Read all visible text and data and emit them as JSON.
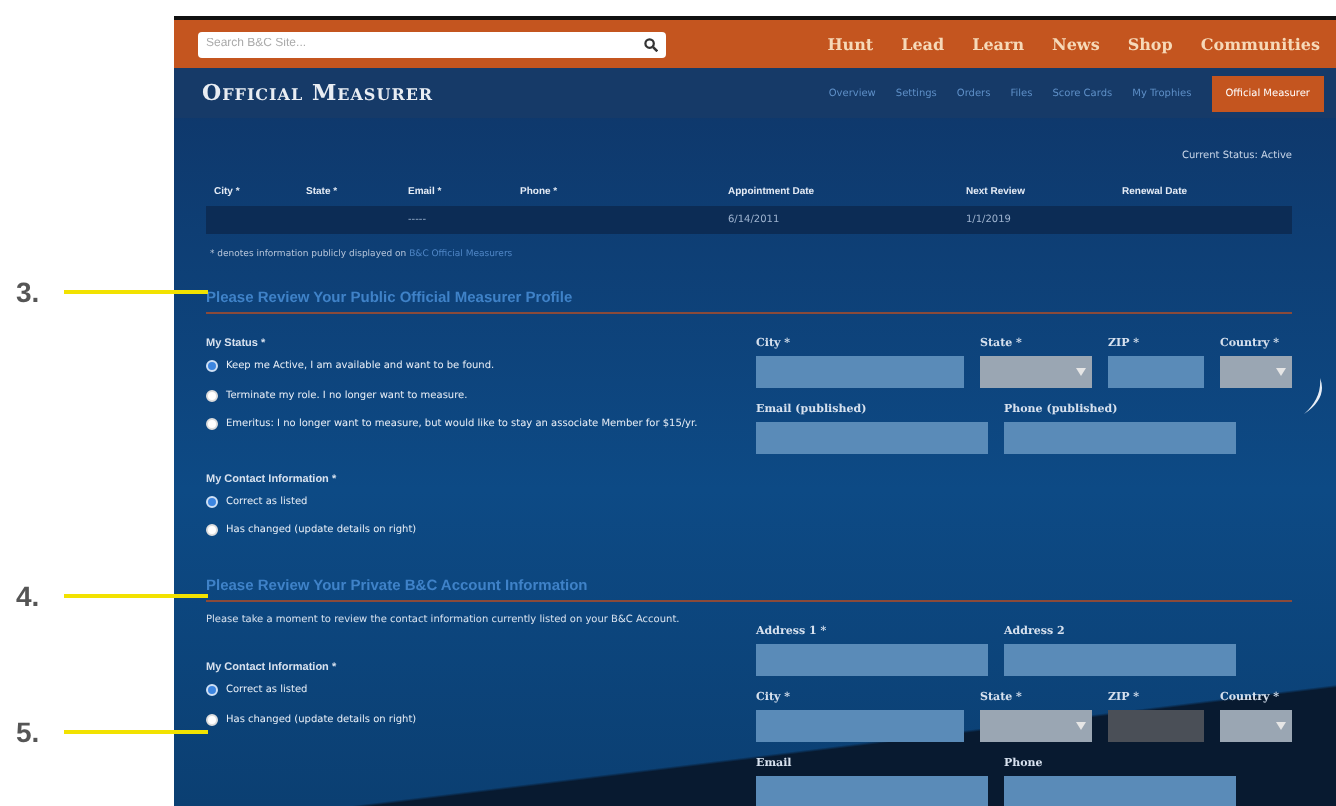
{
  "callouts": [
    {
      "label": "3."
    },
    {
      "label": "4."
    },
    {
      "label": "5."
    }
  ],
  "search": {
    "placeholder": "Search B&C Site..."
  },
  "main_nav": [
    "Hunt",
    "Lead",
    "Learn",
    "News",
    "Shop",
    "Communities"
  ],
  "site_title": "Official Measurer",
  "sub_nav": [
    {
      "label": "Overview",
      "selected": false
    },
    {
      "label": "Settings",
      "selected": false
    },
    {
      "label": "Orders",
      "selected": false
    },
    {
      "label": "Files",
      "selected": false
    },
    {
      "label": "Score Cards",
      "selected": false
    },
    {
      "label": "My Trophies",
      "selected": false
    },
    {
      "label": "Official Measurer",
      "selected": true
    }
  ],
  "current_status": "Current Status: Active",
  "table": {
    "columns": [
      "City *",
      "State *",
      "Email *",
      "Phone *",
      "Appointment Date",
      "Next Review",
      "Renewal Date"
    ],
    "rows": [
      [
        null,
        null,
        "-----",
        null,
        "6/14/2011",
        "1/1/2019",
        null
      ]
    ]
  },
  "footnote": {
    "text": "* denotes information publicly displayed on",
    "link": "B&C Official Measurers"
  },
  "sections": [
    {
      "title": "Please Review Your Public Official Measurer Profile",
      "groups": [
        {
          "label": "My Status *",
          "options": [
            {
              "label": "Keep me Active, I am available and want to be found.",
              "selected": true
            },
            {
              "label": "Terminate my role. I no longer want to measure.",
              "selected": false
            },
            {
              "label": "Emeritus: I no longer want to measure, but would like to stay an associate Member for $15/yr.",
              "selected": false
            }
          ]
        },
        {
          "label": "My Contact Information *",
          "options": [
            {
              "label": "Correct as listed",
              "selected": true
            },
            {
              "label": "Has changed (update details on right)",
              "selected": false
            }
          ]
        }
      ],
      "field_rows": [
        [
          {
            "label": "City *",
            "kind": "input",
            "disabled": false
          },
          {
            "label": "State *",
            "kind": "select",
            "disabled": false
          },
          {
            "label": "ZIP *",
            "kind": "input",
            "disabled": false
          },
          {
            "label": "Country *",
            "kind": "select",
            "disabled": false
          }
        ],
        [
          {
            "label": "Email (published)",
            "kind": "input",
            "disabled": false
          },
          {
            "label": "Phone (published)",
            "kind": "input",
            "disabled": false
          }
        ]
      ]
    },
    {
      "title": "Please Review Your Private B&C Account Information",
      "intro": "Please take a moment to review the contact information currently listed on your B&C Account.",
      "groups": [
        {
          "label": "My Contact Information *",
          "options": [
            {
              "label": "Correct as listed",
              "selected": true
            },
            {
              "label": "Has changed (update details on right)",
              "selected": false
            }
          ]
        }
      ],
      "field_rows": [
        [
          {
            "label": "Address 1 *",
            "kind": "input",
            "disabled": false
          },
          {
            "label": "Address 2",
            "kind": "input",
            "disabled": false
          }
        ],
        [
          {
            "label": "City *",
            "kind": "input",
            "disabled": false
          },
          {
            "label": "State *",
            "kind": "select",
            "disabled": false
          },
          {
            "label": "ZIP *",
            "kind": "input",
            "disabled": true
          },
          {
            "label": "Country *",
            "kind": "select",
            "disabled": false
          }
        ],
        [
          {
            "label": "Email",
            "kind": "input",
            "disabled": false
          },
          {
            "label": "Phone",
            "kind": "input",
            "disabled": false
          }
        ]
      ]
    }
  ]
}
